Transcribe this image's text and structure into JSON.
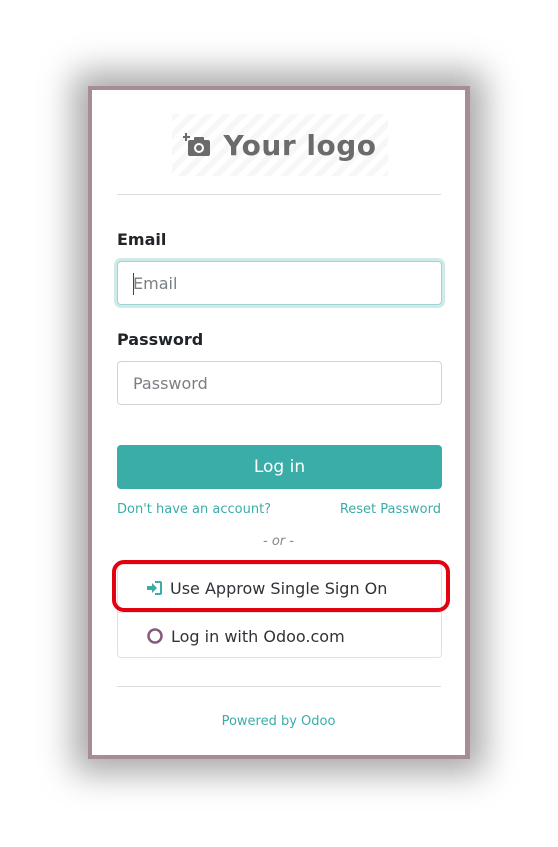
{
  "logo": {
    "text": "Your logo",
    "icon": "camera-add-icon"
  },
  "form": {
    "email_label": "Email",
    "email_placeholder": "Email",
    "password_label": "Password",
    "password_placeholder": "Password",
    "login_button": "Log in",
    "signup_link": "Don't have an account?",
    "reset_link": "Reset Password",
    "separator": "- or -"
  },
  "oauth": {
    "items": [
      {
        "label": "Use Approw Single Sign On",
        "icon": "sign-in-icon"
      },
      {
        "label": "Log in with Odoo.com",
        "icon": "odoo-circle-icon"
      }
    ]
  },
  "footer": {
    "powered_by": "Powered by Odoo"
  },
  "colors": {
    "primary": "#3aada9",
    "highlight": "#e3000f",
    "odoo": "#875a7b"
  }
}
